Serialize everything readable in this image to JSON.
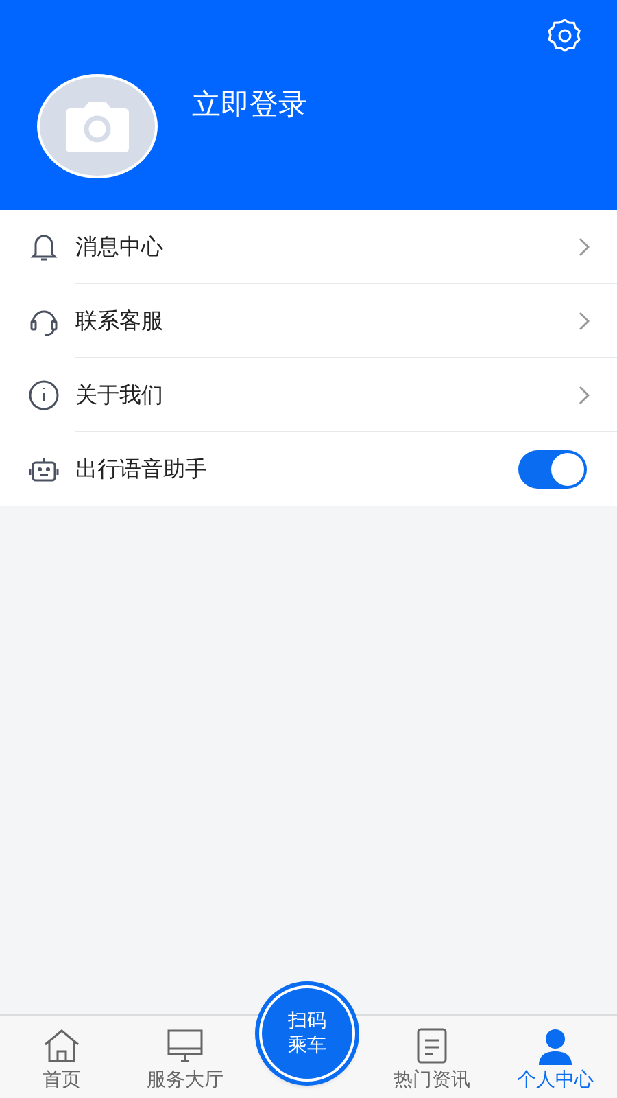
{
  "header": {
    "login_label": "立即登录"
  },
  "menu": [
    {
      "kind": "link",
      "label": "消息中心"
    },
    {
      "kind": "link",
      "label": "联系客服"
    },
    {
      "kind": "link",
      "label": "关于我们"
    },
    {
      "kind": "toggle",
      "label": "出行语音助手",
      "on": true
    }
  ],
  "tab_bar": {
    "tabs": [
      {
        "label": "首页",
        "selected": false
      },
      {
        "label": "服务大厅",
        "selected": false
      },
      {
        "label": "热门资讯",
        "selected": false
      },
      {
        "label": "个人中心",
        "selected": true
      }
    ],
    "scan_button": [
      "扫码",
      "乘车"
    ]
  }
}
